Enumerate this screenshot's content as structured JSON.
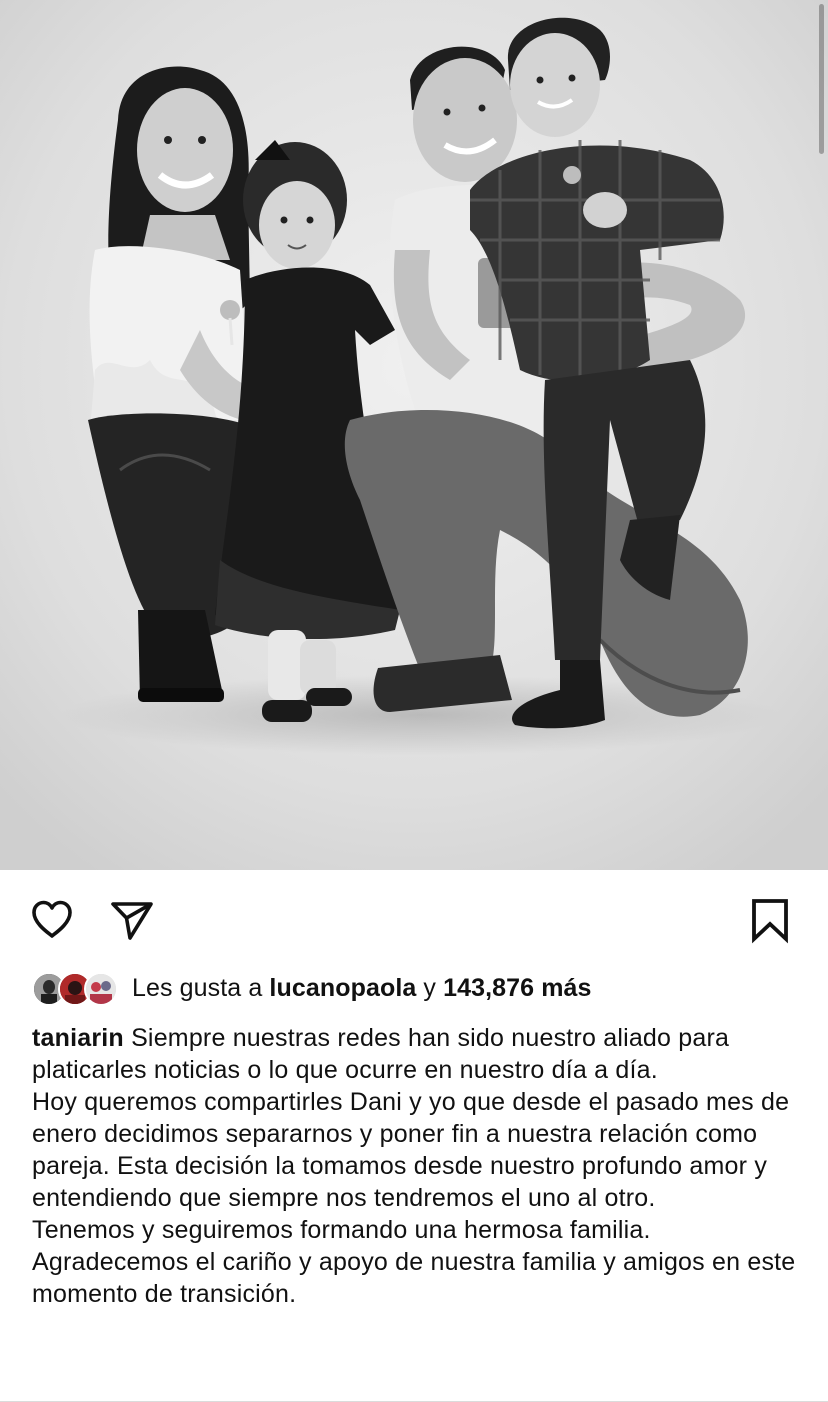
{
  "post": {
    "photo": {
      "style": "black-and-white family portrait"
    },
    "actions": {
      "like_icon": "heart-outline-icon",
      "share_icon": "paper-plane-icon",
      "save_icon": "bookmark-outline-icon"
    },
    "likes": {
      "prefix": "Les gusta a ",
      "user": "lucanopaola",
      "connector": " y ",
      "count": "143,876 más"
    },
    "caption": {
      "username": "taniarin",
      "lines": [
        "Siempre nuestras redes han sido nuestro aliado para platicarles noticias o lo que ocurre en nuestro día a día.",
        "Hoy queremos compartirles Dani y yo que desde el pasado mes de enero decidimos separarnos y poner fin a nuestra relación como pareja. Esta decisión la tomamos desde nuestro profundo amor y entendiendo que siempre nos tendremos el uno al otro.",
        "Tenemos y seguiremos formando una hermosa familia.",
        "Agradecemos el cariño y apoyo de nuestra familia y amigos en este momento de transición."
      ]
    },
    "colors": {
      "text": "#111111",
      "background": "#ffffff"
    }
  }
}
